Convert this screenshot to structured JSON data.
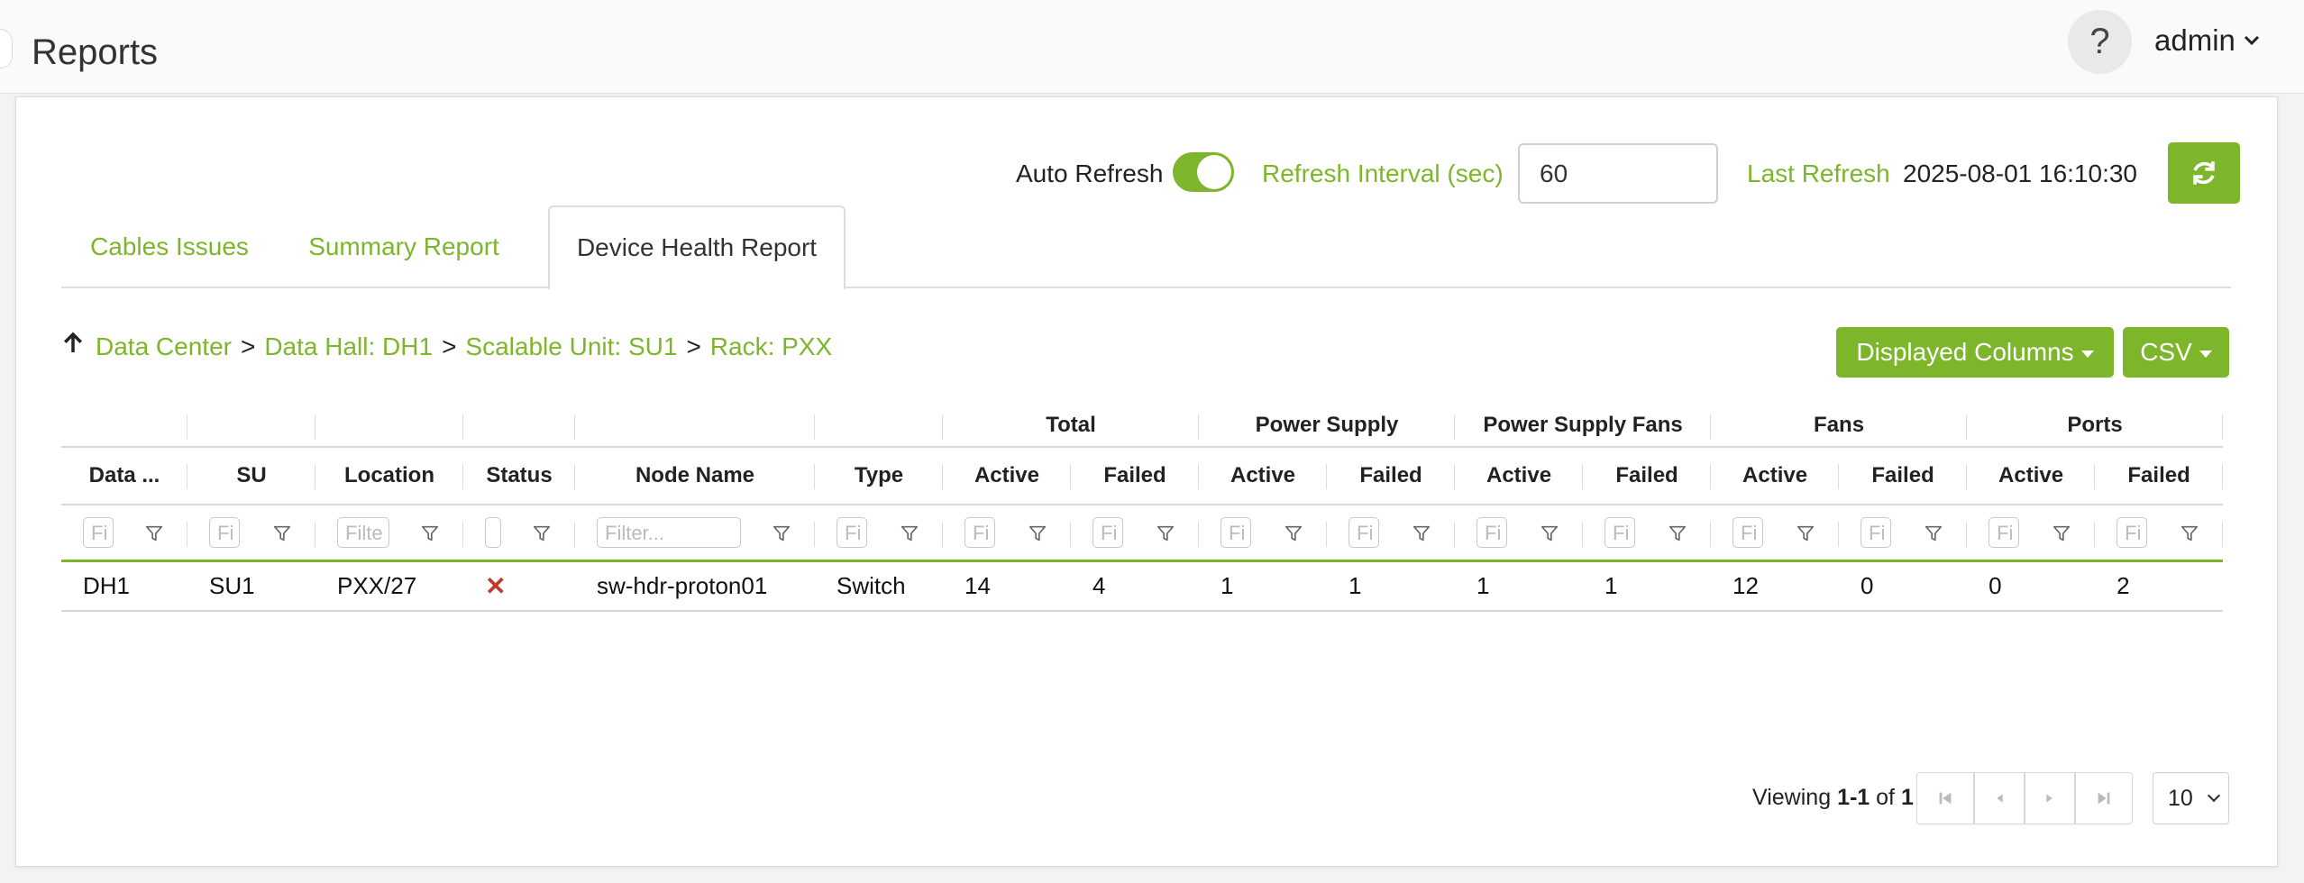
{
  "header": {
    "title": "Reports",
    "help_label": "?",
    "user": "admin"
  },
  "refresh": {
    "auto_label": "Auto Refresh",
    "auto_on": true,
    "interval_label": "Refresh Interval (sec)",
    "interval_value": "60",
    "last_label": "Last Refresh",
    "last_value": "2025-08-01 16:10:30"
  },
  "tabs": [
    {
      "label": "Cables Issues",
      "active": false
    },
    {
      "label": "Summary Report",
      "active": false
    },
    {
      "label": "Device Health Report",
      "active": true
    }
  ],
  "breadcrumb": [
    {
      "label": "Data Center"
    },
    {
      "label": "Data Hall: DH1"
    },
    {
      "label": "Scalable Unit: SU1"
    },
    {
      "label": "Rack: PXX"
    }
  ],
  "breadcrumb_sep": ">",
  "actions": {
    "displayed_columns": "Displayed Columns",
    "csv": "CSV"
  },
  "table": {
    "groups": [
      "",
      "",
      "",
      "",
      "",
      "",
      "Total",
      "Power Supply",
      "Power Supply Fans",
      "Fans",
      "Ports"
    ],
    "columns": [
      "Data ...",
      "SU",
      "Location",
      "Status",
      "Node Name",
      "Type",
      "Active",
      "Failed",
      "Active",
      "Failed",
      "Active",
      "Failed",
      "Active",
      "Failed",
      "Active",
      "Failed"
    ],
    "filter_placeholders": [
      "Fi",
      "Fi",
      "Filte",
      "",
      "Filter...",
      "Fi",
      "Fi",
      "Fi",
      "Fi",
      "Fi",
      "Fi",
      "Fi",
      "Fi",
      "Fi",
      "Fi",
      "Fi"
    ],
    "rows": [
      [
        "DH1",
        "SU1",
        "PXX/27",
        "✕",
        "sw-hdr-proton01",
        "Switch",
        "14",
        "4",
        "1",
        "1",
        "1",
        "1",
        "12",
        "0",
        "0",
        "2"
      ]
    ]
  },
  "pagination": {
    "viewing_prefix": "Viewing",
    "viewing_range": "1-1",
    "viewing_of": "of",
    "viewing_total": "1",
    "page_size": "10"
  },
  "colors": {
    "accent": "#7db52b",
    "error": "#c0392b"
  }
}
